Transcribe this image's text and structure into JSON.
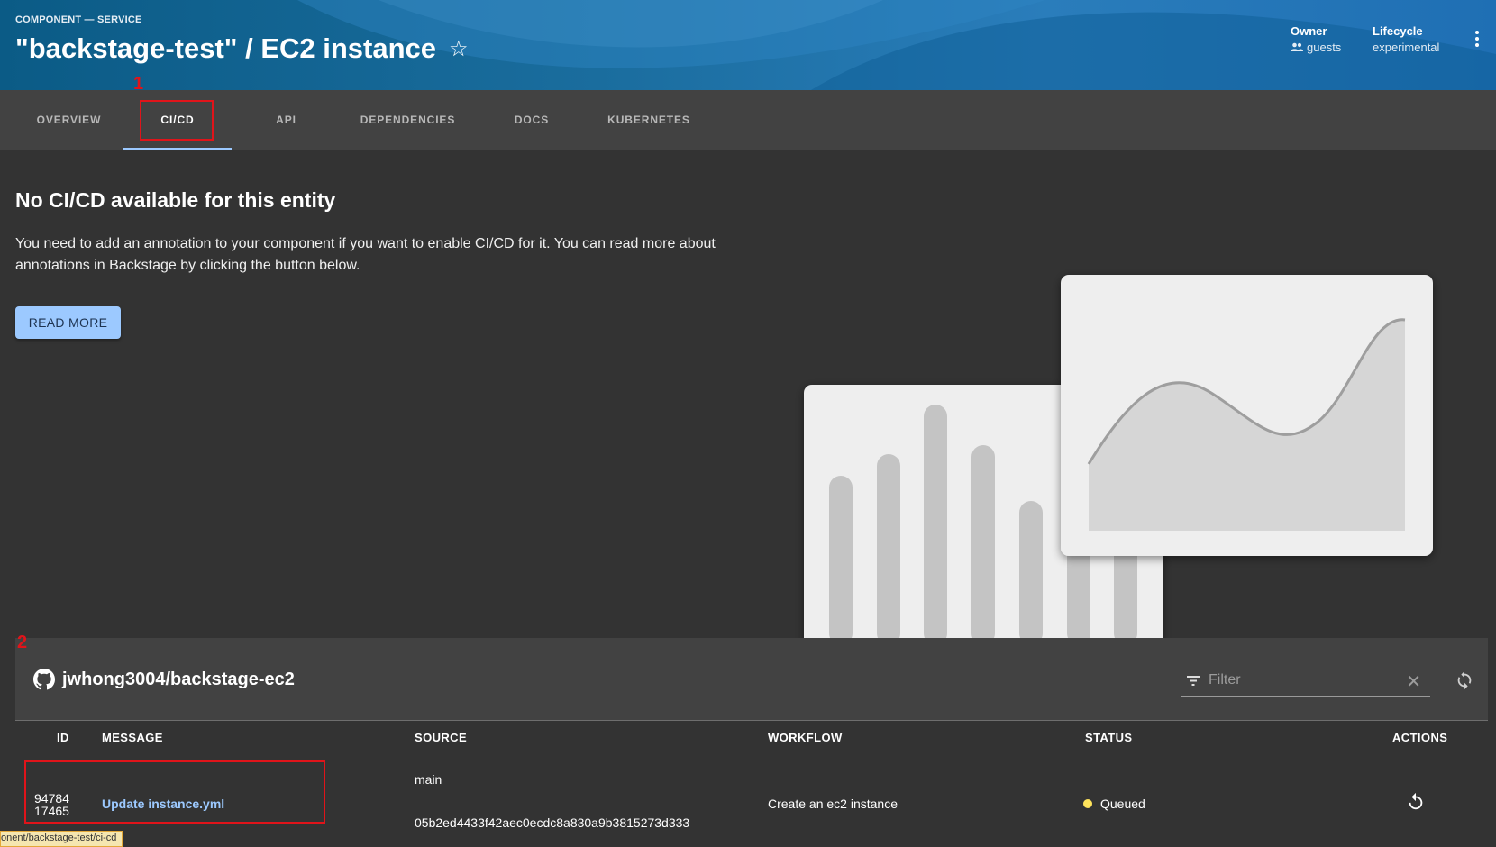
{
  "header": {
    "kicker": "COMPONENT — SERVICE",
    "title": "\"backstage-test\" / EC2 instance",
    "owner_label": "Owner",
    "owner_value": "guests",
    "lifecycle_label": "Lifecycle",
    "lifecycle_value": "experimental"
  },
  "tabs": [
    {
      "label": "OVERVIEW"
    },
    {
      "label": "CI/CD",
      "active": true
    },
    {
      "label": "API"
    },
    {
      "label": "DEPENDENCIES"
    },
    {
      "label": "DOCS"
    },
    {
      "label": "KUBERNETES"
    }
  ],
  "annotations": {
    "one": "1",
    "two": "2"
  },
  "empty_state": {
    "title": "No CI/CD available for this entity",
    "description": "You need to add an annotation to your component if you want to enable CI/CD for it. You can read more about annotations in Backstage by clicking the button below.",
    "button": "READ MORE"
  },
  "workflow_runs": {
    "repo": "jwhong3004/backstage-ec2",
    "filter_placeholder": "Filter",
    "columns": [
      "ID",
      "MESSAGE",
      "SOURCE",
      "WORKFLOW",
      "STATUS",
      "ACTIONS"
    ],
    "rows": [
      {
        "id_line1": "94784",
        "id_line2": "17465",
        "message": "Update instance.yml",
        "branch": "main",
        "sha": "05b2ed4433f42aec0ecdc8a830a9b3815273d333",
        "workflow": "Create an ec2 instance",
        "status": "Queued"
      }
    ]
  },
  "status_bar": {
    "url": "onent/backstage-test/ci-cd"
  },
  "colors": {
    "accent": "#9cc9ff",
    "annotation": "#e0141a",
    "status_queued": "#ffe45c",
    "header": "#1a6d9e"
  }
}
